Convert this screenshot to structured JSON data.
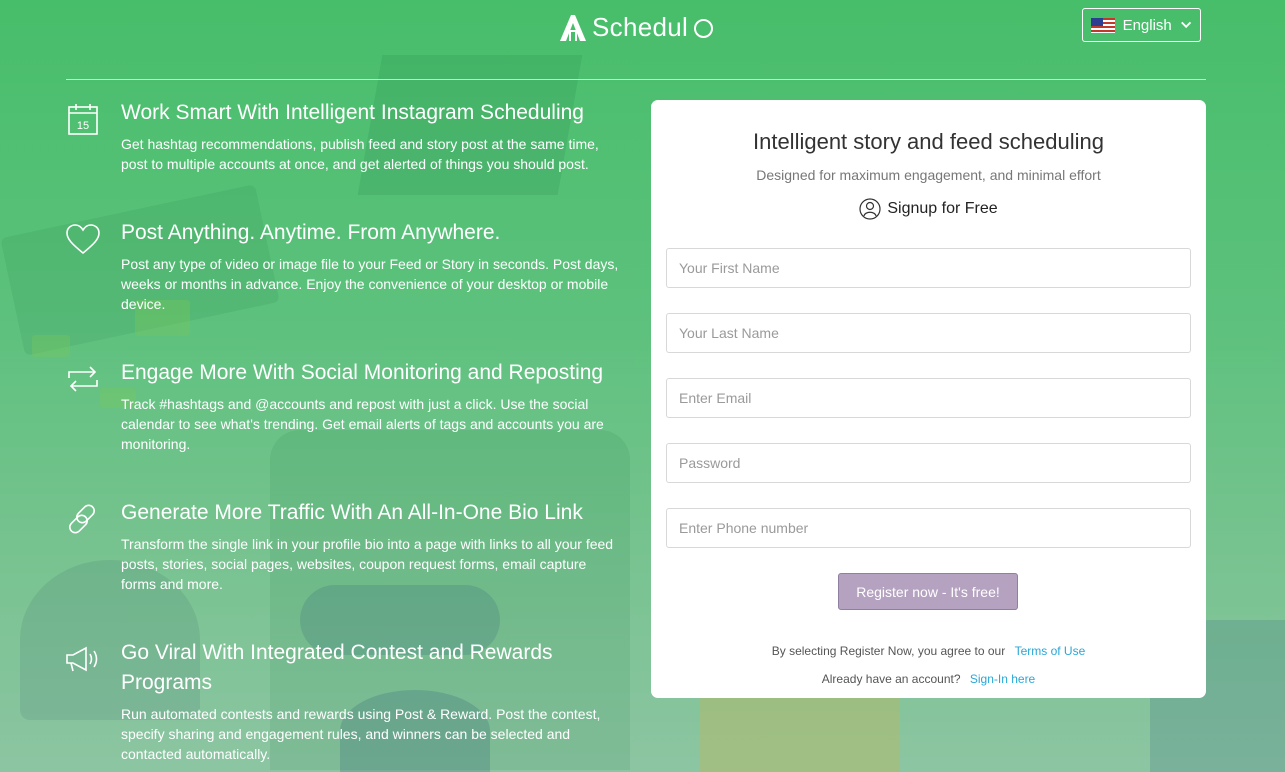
{
  "header": {
    "logo_text": "Schedul",
    "language": {
      "label": "English",
      "flag_icon": "us-flag-icon"
    }
  },
  "features": [
    {
      "icon": "calendar-icon",
      "calendar_day": "15",
      "title": "Work Smart With Intelligent Instagram Scheduling",
      "desc_lines": [
        "Get hashtag recommendations, publish feed and story post at the same time,",
        "post to multiple accounts at once, and get alerted of things you should post."
      ]
    },
    {
      "icon": "heart-icon",
      "title": "Post Anything. Anytime. From Anywhere.",
      "desc_lines": [
        "Post any type of video or image file to your Feed or Story in seconds. Post days,",
        "weeks or months in advance. Enjoy the convenience of your desktop or mobile",
        "device."
      ]
    },
    {
      "icon": "repost-icon",
      "title": "Engage More With Social Monitoring and Reposting",
      "desc_lines": [
        "Track #hashtags and @accounts and repost with just a click. Use the social",
        "calendar to see what's trending. Get email alerts of tags and accounts you are",
        "monitoring."
      ]
    },
    {
      "icon": "link-icon",
      "title": "Generate More Traffic With An All-In-One Bio Link",
      "desc_lines": [
        "Transform the single link in your profile bio into a page with links to all your feed",
        "posts, stories, social pages, websites, coupon request forms, email capture",
        "forms and more."
      ]
    },
    {
      "icon": "megaphone-icon",
      "title_lines": [
        "Go Viral With Integrated Contest and Rewards",
        "Programs"
      ],
      "desc_lines": [
        "Run automated contests and rewards using Post & Reward. Post the contest,",
        "specify sharing and engagement rules, and winners can be selected and",
        "contacted automatically."
      ]
    }
  ],
  "form": {
    "title": "Intelligent story and feed scheduling",
    "subtitle": "Designed for maximum engagement, and minimal effort",
    "signup_label": "Signup for Free",
    "signup_icon": "user-circle-icon",
    "fields": {
      "first_name": {
        "placeholder": "Your First Name",
        "value": ""
      },
      "last_name": {
        "placeholder": "Your Last Name",
        "value": ""
      },
      "email": {
        "placeholder": "Enter Email",
        "value": ""
      },
      "password": {
        "placeholder": "Password",
        "value": ""
      },
      "phone": {
        "placeholder": "Enter Phone number",
        "value": ""
      }
    },
    "register_label": "Register now - It's free!",
    "terms_text": "By selecting Register Now, you agree to our",
    "terms_link": "Terms of Use",
    "signin_text": "Already have an account?",
    "signin_link": "Sign-In here"
  },
  "colors": {
    "background_green": "#47be6a",
    "register_button": "#b5a2c0",
    "link": "#2aa7d8"
  }
}
